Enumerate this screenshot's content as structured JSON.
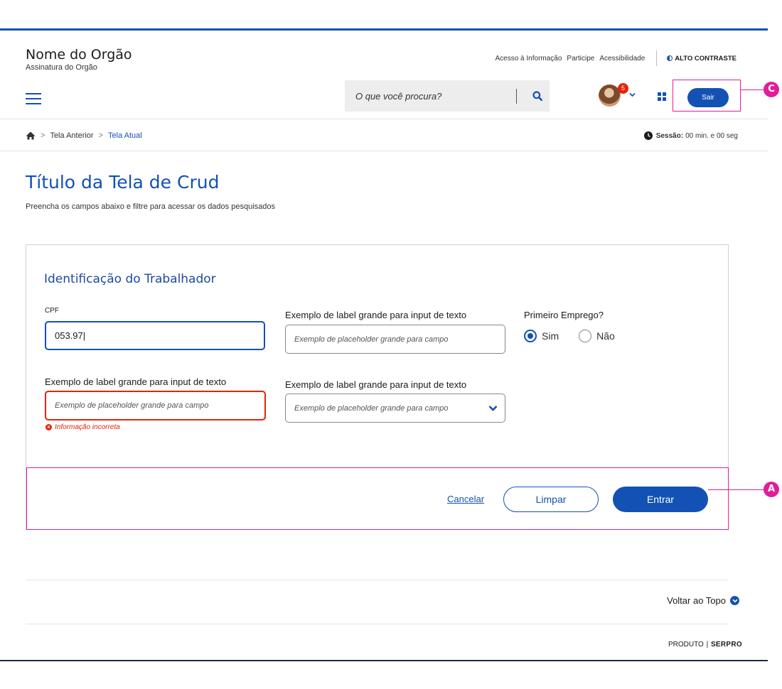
{
  "header": {
    "org_name": "Nome do Orgão",
    "org_subtitle": "Assinatura do Orgão",
    "links": [
      "Acesso à Informação",
      "Participe",
      "Acessibilidade"
    ],
    "contrast_label": "ALTO CONTRASTE",
    "search_placeholder": "O que você procura?",
    "notification_count": "5",
    "logout_label": "Sair"
  },
  "breadcrumb": {
    "items": [
      "Tela Anterior",
      "Tela Atual"
    ]
  },
  "session": {
    "label": "Sessão:",
    "value": "00 min. e 00 seg"
  },
  "page": {
    "title": "Título da Tela de Crud",
    "description": "Preencha os campos abaixo e filtre para acessar os dados pesquisados"
  },
  "form": {
    "section_title": "Identificação do Trabalhador",
    "cpf_label": "CPF",
    "cpf_value": "053.97|",
    "label_big": "Exemplo de label grande para input de texto",
    "placeholder_big": "Exemplo de placeholder grande para campo",
    "first_job_label": "Primeiro Emprego?",
    "radio_yes": "Sim",
    "radio_no": "Não",
    "error_message": "Informação incorreta",
    "cancel": "Cancelar",
    "clear": "Limpar",
    "submit": "Entrar"
  },
  "annotations": {
    "a": "A",
    "c": "C"
  },
  "footer": {
    "back_to_top": "Voltar ao Topo",
    "brand_prefix": "PRODUTO",
    "brand_name": "SERPRO"
  },
  "colors": {
    "primary": "#1351b4",
    "error": "#e52207",
    "annotation": "#e01e9a"
  }
}
